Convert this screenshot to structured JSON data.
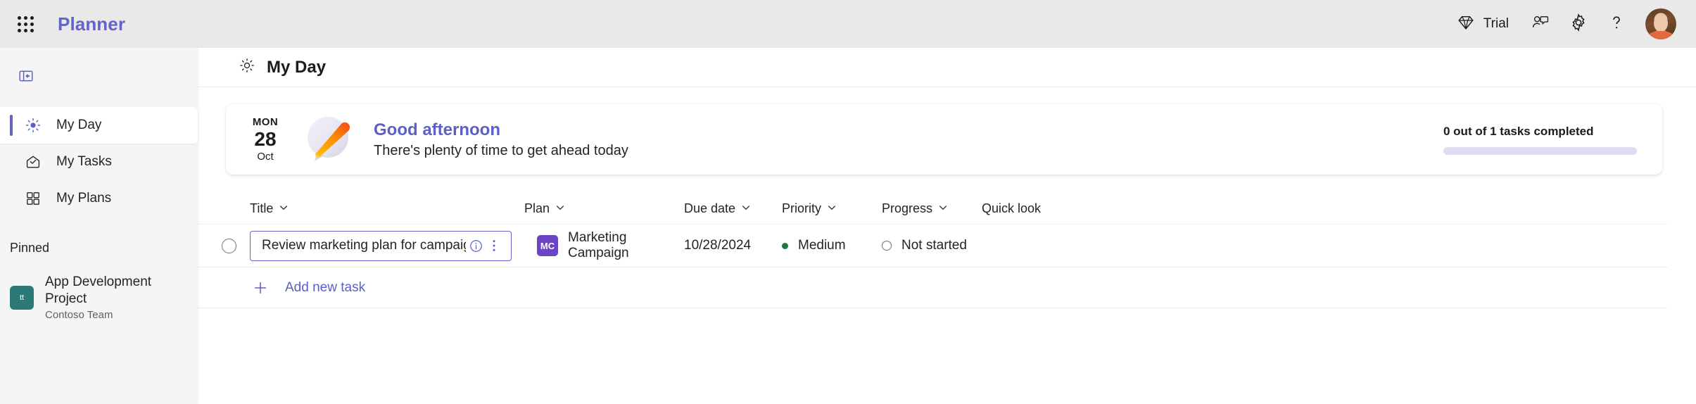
{
  "topbar": {
    "waffle_label": "app-launcher",
    "brand": "Planner",
    "trial_label": "Trial",
    "icons": {
      "diamond": "diamond-icon",
      "feedback": "feedback-icon",
      "settings": "gear-icon",
      "help": "help-icon",
      "avatar": "user-avatar"
    }
  },
  "sidebar": {
    "collapse_icon": "collapse-panel-icon",
    "items": [
      {
        "label": "My Day",
        "icon": "sun-icon",
        "selected": true
      },
      {
        "label": "My Tasks",
        "icon": "tasks-inbox-icon",
        "selected": false
      },
      {
        "label": "My Plans",
        "icon": "grid-icon",
        "selected": false
      }
    ],
    "pinned_header": "Pinned",
    "pinned": [
      {
        "initials": "tt",
        "name": "App Development Project",
        "subtitle": "Contoso Team",
        "color": "#2b7a78"
      }
    ]
  },
  "main": {
    "page_title": "My Day",
    "page_icon": "sun-icon",
    "greeting": {
      "day_of_week": "MON",
      "day": "28",
      "month": "Oct",
      "title": "Good afternoon",
      "subtitle": "There's plenty of time to get ahead today",
      "progress_label": "0 out of 1 tasks completed",
      "progress_percent": 0,
      "accent_color": "#5b5fc7",
      "track_color": "#dcdcf5"
    },
    "table": {
      "columns": [
        {
          "key": "title",
          "label": "Title",
          "sortable": true
        },
        {
          "key": "plan",
          "label": "Plan",
          "sortable": true
        },
        {
          "key": "due",
          "label": "Due date",
          "sortable": true
        },
        {
          "key": "priority",
          "label": "Priority",
          "sortable": true
        },
        {
          "key": "progress",
          "label": "Progress",
          "sortable": true
        },
        {
          "key": "quick",
          "label": "Quick look",
          "sortable": false
        }
      ],
      "rows": [
        {
          "completed": false,
          "title": "Review marketing plan for campaign budget",
          "plan_initials": "MC",
          "plan_name": "Marketing Campaign",
          "plan_color": "#6b44c4",
          "due_date": "10/28/2024",
          "priority": "Medium",
          "priority_color": "#1d7b3e",
          "progress": "Not started",
          "quick_look": ""
        }
      ],
      "add_task_label": "Add new task"
    }
  }
}
